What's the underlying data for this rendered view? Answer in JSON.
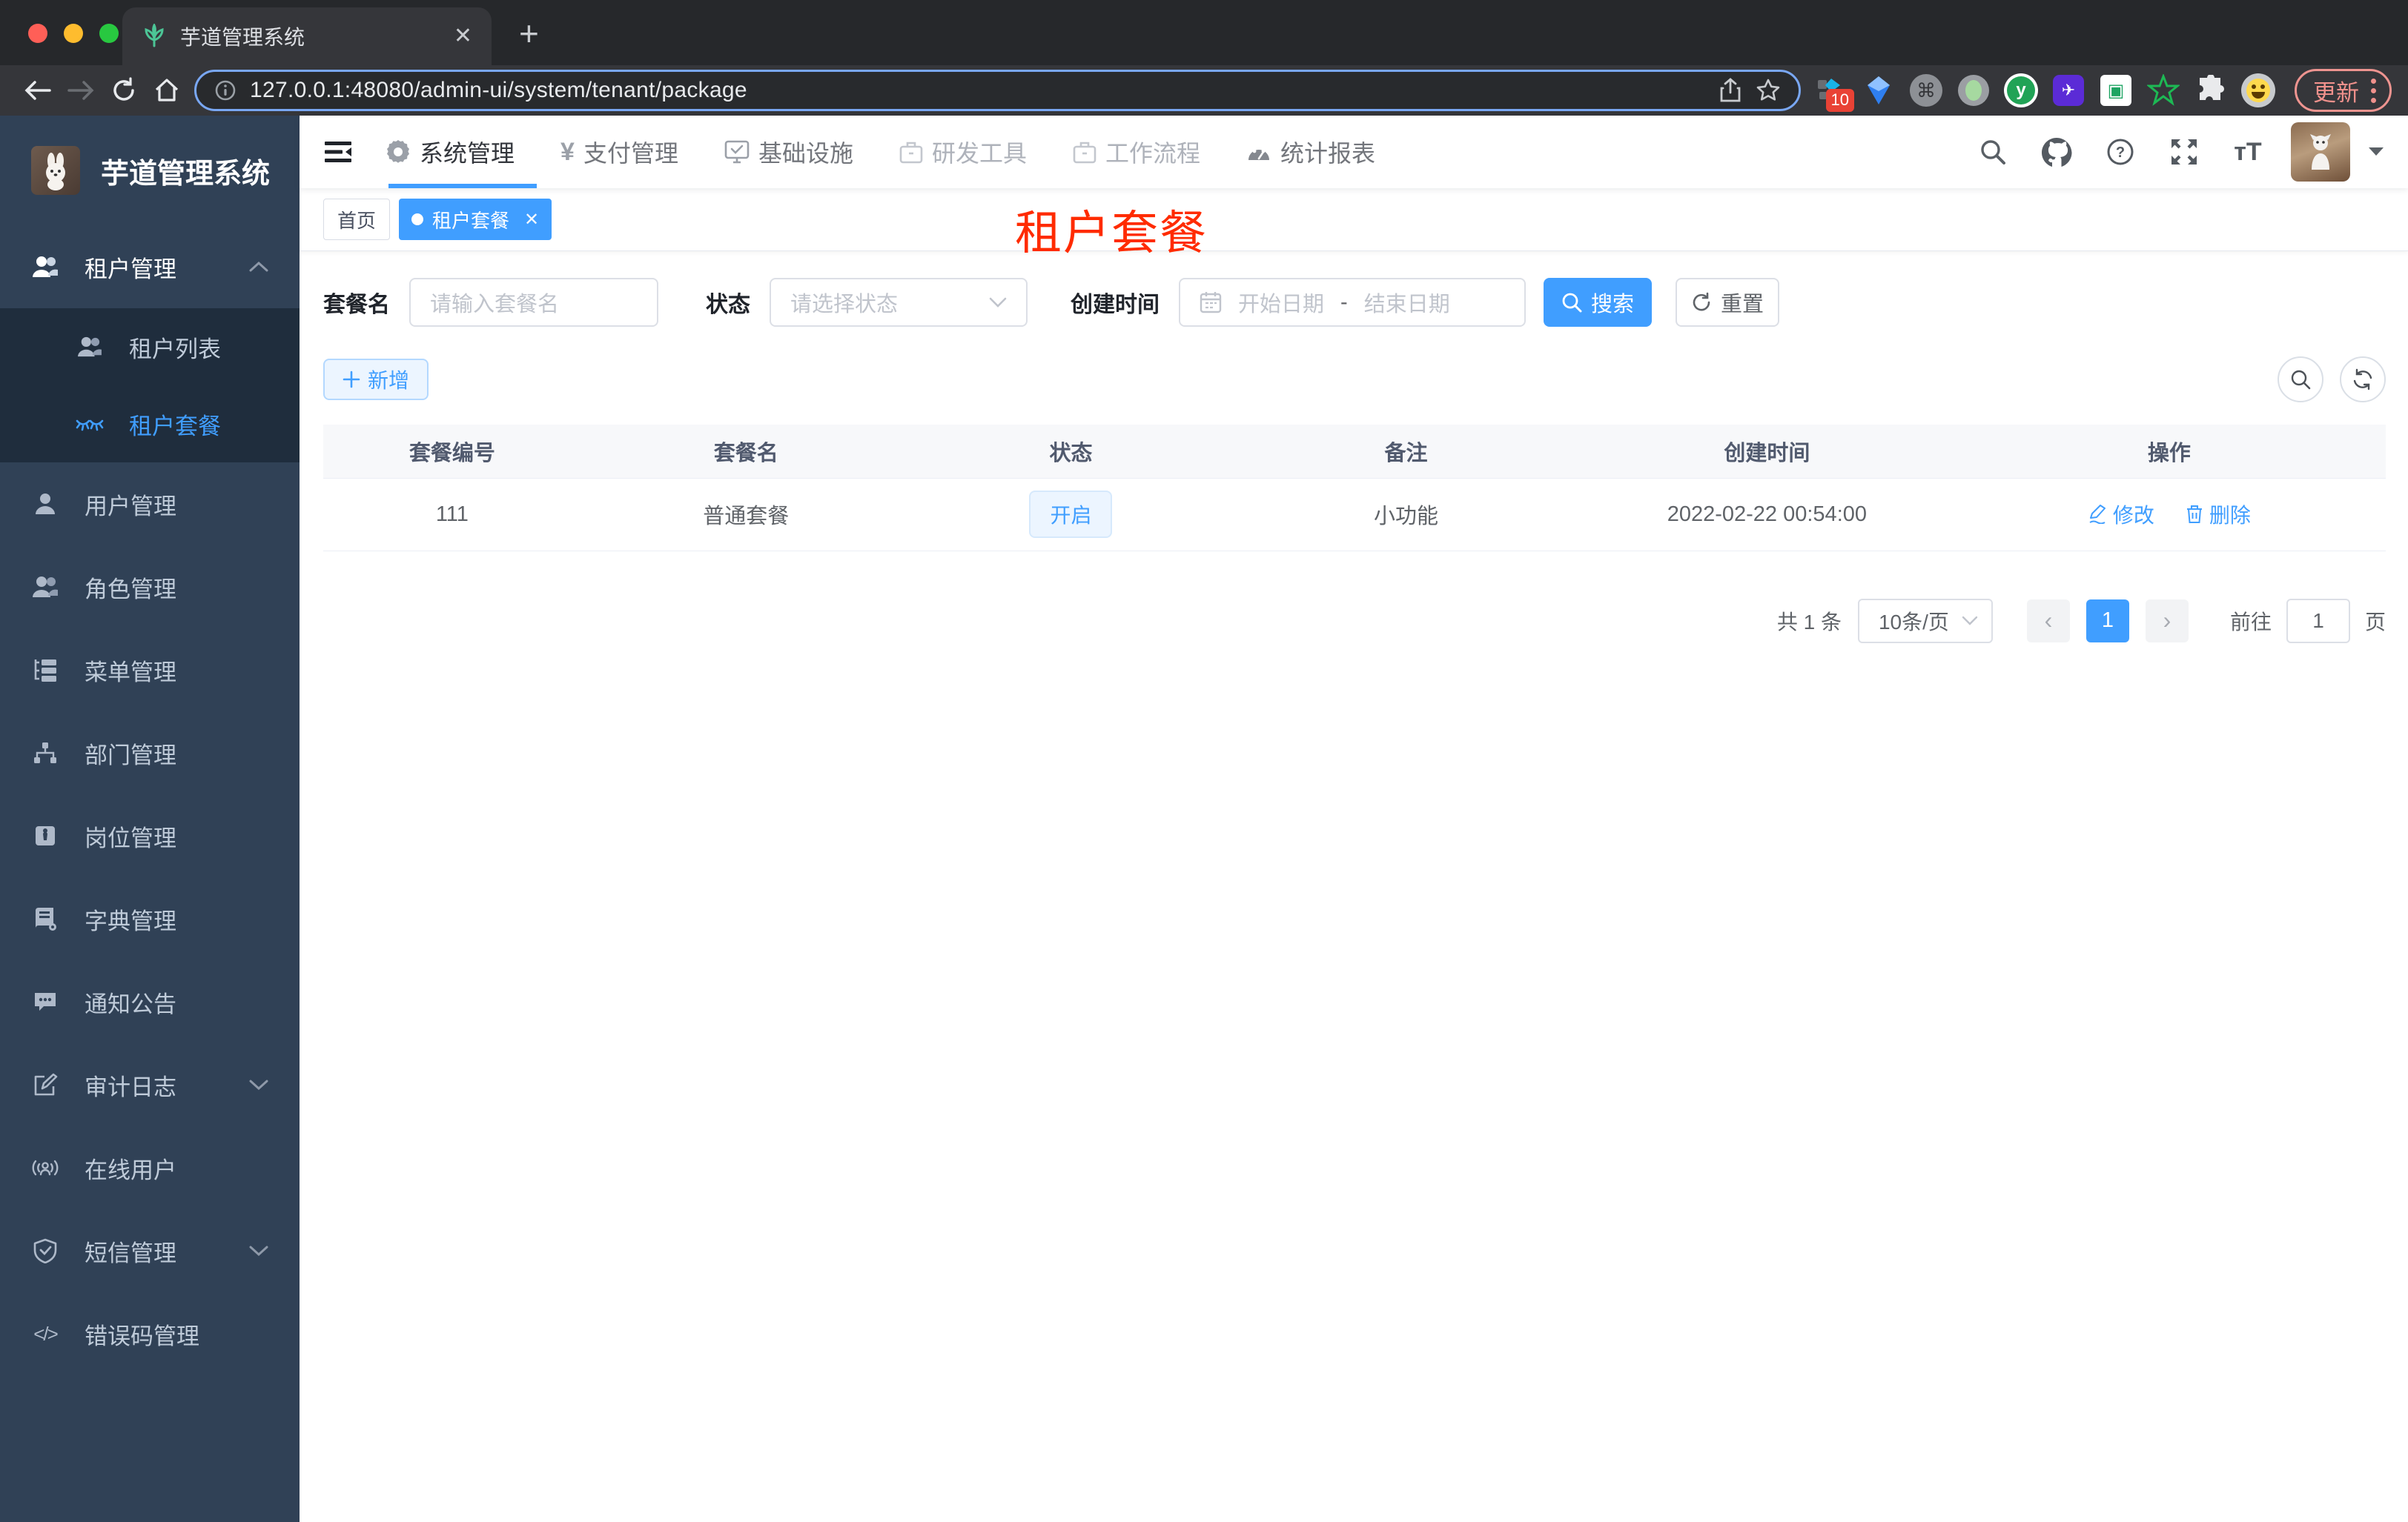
{
  "colors": {
    "accent": "#409eff",
    "overlay_red": "#ff2b00",
    "sidebar_bg": "#304156",
    "submenu_bg": "#1f2d3d"
  },
  "browser": {
    "tab_title": "芋道管理系统",
    "tab_close": "✕",
    "new_tab": "+",
    "url": "127.0.0.1:48080/admin-ui/system/tenant/package",
    "extension_badge": "10",
    "cmd_glyph": "⌘",
    "y_glyph": "y",
    "shield_glyph": "✈",
    "chat_glyph": "▣",
    "update_label": "更新"
  },
  "app_header": {
    "nav": [
      {
        "label": "系统管理"
      },
      {
        "label": "支付管理"
      },
      {
        "label": "基础设施"
      },
      {
        "label": "研发工具"
      },
      {
        "label": "工作流程"
      },
      {
        "label": "统计报表"
      }
    ],
    "yen_glyph": "¥",
    "font_size_glyph": "тT"
  },
  "sidebar": {
    "title": "芋道管理系统",
    "group_tenant": {
      "label": "租户管理"
    },
    "sub_items": [
      {
        "label": "租户列表"
      },
      {
        "label": "租户套餐"
      }
    ],
    "items": [
      {
        "label": "用户管理"
      },
      {
        "label": "角色管理"
      },
      {
        "label": "菜单管理"
      },
      {
        "label": "部门管理"
      },
      {
        "label": "岗位管理"
      },
      {
        "label": "字典管理"
      },
      {
        "label": "通知公告"
      },
      {
        "label": "审计日志"
      },
      {
        "label": "在线用户"
      },
      {
        "label": "短信管理"
      },
      {
        "label": "错误码管理"
      }
    ],
    "code_glyph": "</>"
  },
  "tags": {
    "home": "首页",
    "active": "租户套餐",
    "close": "✕"
  },
  "overlay_title": "租户套餐",
  "filters": {
    "name_label": "套餐名",
    "name_placeholder": "请输入套餐名",
    "status_label": "状态",
    "status_placeholder": "请选择状态",
    "time_label": "创建时间",
    "start_placeholder": "开始日期",
    "range_separator": "-",
    "end_placeholder": "结束日期",
    "search_label": "搜索",
    "reset_label": "重置"
  },
  "toolbar": {
    "add_label": "新增"
  },
  "table": {
    "headers": [
      "套餐编号",
      "套餐名",
      "状态",
      "备注",
      "创建时间",
      "操作"
    ],
    "rows": [
      {
        "id": "111",
        "name": "普通套餐",
        "status": "开启",
        "remark": "小功能",
        "created": "2022-02-22 00:54:00",
        "edit_label": "修改",
        "delete_label": "删除"
      }
    ]
  },
  "pagination": {
    "total": "共 1 条",
    "page_size": "10条/页",
    "prev_glyph": "‹",
    "next_glyph": "›",
    "current_page": "1",
    "goto_prefix": "前往",
    "goto_value": "1",
    "goto_suffix": "页"
  }
}
